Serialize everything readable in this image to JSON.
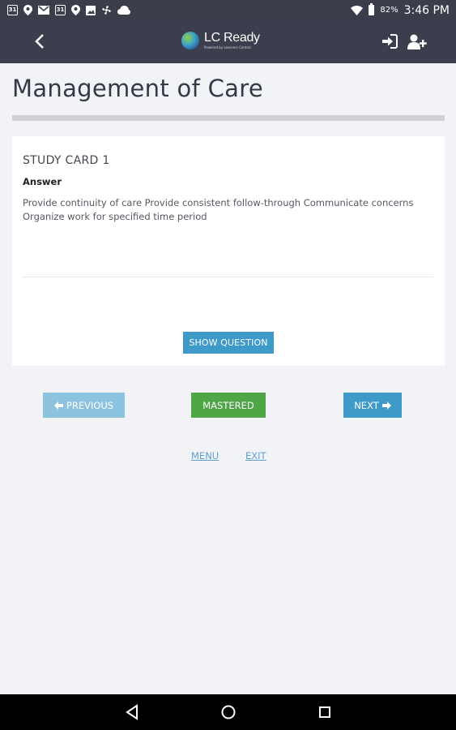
{
  "status_bar": {
    "left_icons": [
      "calendar-icon",
      "location-icon",
      "gmail-icon",
      "calendar-icon",
      "location-icon",
      "image-icon",
      "fan-icon",
      "cloud-icon"
    ],
    "calendar_day": "31",
    "battery": "82%",
    "time": "3:46 PM"
  },
  "header": {
    "logo_text": "LC Ready",
    "logo_subtext": "Powered by Learners Central",
    "icons": [
      "back-icon",
      "login-icon",
      "add-user-icon"
    ]
  },
  "page": {
    "title": "Management of Care"
  },
  "card": {
    "label": "STUDY CARD 1",
    "answer_heading": "Answer",
    "answer_text": "Provide continuity of care  Provide consistent follow-through  Communicate concerns  Organize work for specified time period",
    "show_question_label": "SHOW QUESTION"
  },
  "navigation": {
    "previous_label": "PREVIOUS",
    "mastered_label": "MASTERED",
    "next_label": "NEXT"
  },
  "links": {
    "menu": "MENU",
    "exit": "EXIT"
  },
  "colors": {
    "header_bg": "#3b3f4d",
    "primary_blue": "#3e9bc9",
    "disabled_blue": "#8cc3de",
    "mastered_green": "#4ea646",
    "link_blue": "#5e9fcf",
    "page_bg": "#f2f3f7"
  }
}
